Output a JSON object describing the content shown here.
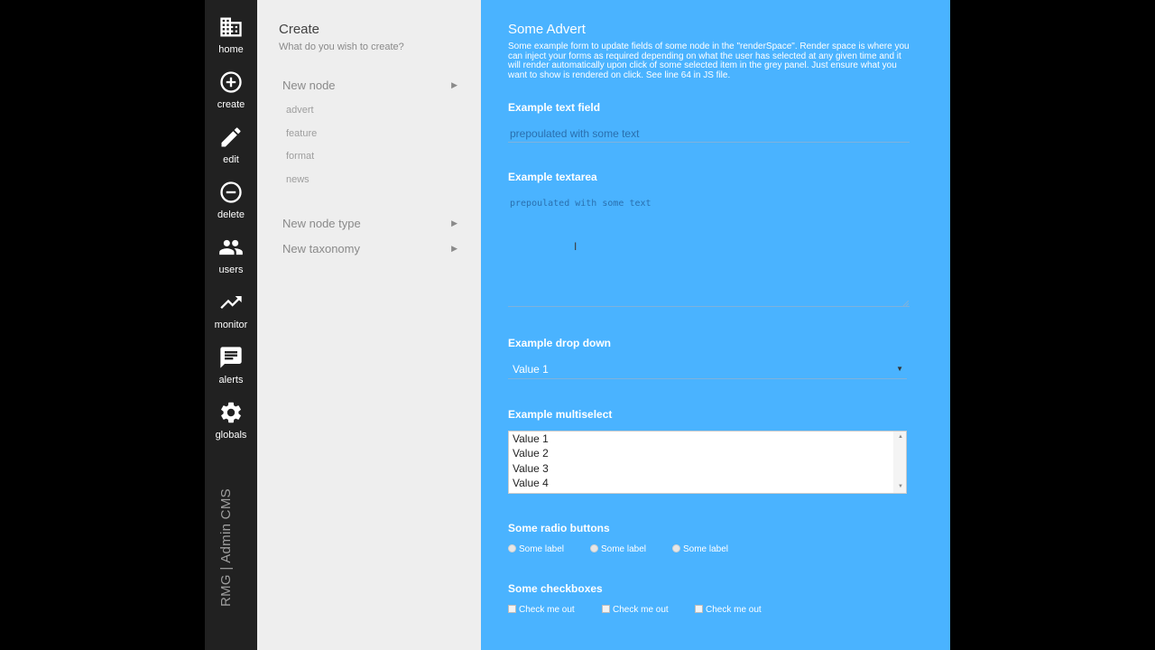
{
  "nav": {
    "items": [
      {
        "label": "home",
        "icon": "building-icon"
      },
      {
        "label": "create",
        "icon": "plus-circle-icon"
      },
      {
        "label": "edit",
        "icon": "pencil-icon"
      },
      {
        "label": "delete",
        "icon": "minus-circle-icon"
      },
      {
        "label": "users",
        "icon": "users-icon"
      },
      {
        "label": "monitor",
        "icon": "trending-up-icon"
      },
      {
        "label": "alerts",
        "icon": "chat-bubble-icon"
      },
      {
        "label": "globals",
        "icon": "gear-icon"
      }
    ],
    "brand": "RMG | Admin CMS"
  },
  "panel": {
    "title": "Create",
    "subtitle": "What do you wish to create?",
    "menu": [
      {
        "label": "New node",
        "children": [
          "advert",
          "feature",
          "format",
          "news"
        ]
      },
      {
        "label": "New node type"
      },
      {
        "label": "New taxonomy"
      }
    ]
  },
  "form": {
    "title": "Some Advert",
    "description": "Some example form to update fields of some node in the \"renderSpace\". Render space is where you can inject your forms as required depending on what the user has selected at any given time and it will render automatically upon click of some selected item in the grey panel. Just ensure what you want to show is rendered on click. See line 64 in JS file.",
    "text_field": {
      "label": "Example text field",
      "value": "prepoulated with some text"
    },
    "textarea": {
      "label": "Example textarea",
      "value": "prepoulated with some text"
    },
    "dropdown": {
      "label": "Example drop down",
      "value": "Value 1"
    },
    "multiselect": {
      "label": "Example multiselect",
      "options": [
        "Value 1",
        "Value 2",
        "Value 3",
        "Value 4"
      ]
    },
    "radios": {
      "label": "Some radio buttons",
      "options": [
        "Some label",
        "Some label",
        "Some label"
      ]
    },
    "checkboxes": {
      "label": "Some checkboxes",
      "options": [
        "Check me out",
        "Check me out",
        "Check me out"
      ]
    }
  },
  "colors": {
    "nav_bg": "#212121",
    "panel_bg": "#eeeeee",
    "form_bg": "#4ab3ff"
  }
}
